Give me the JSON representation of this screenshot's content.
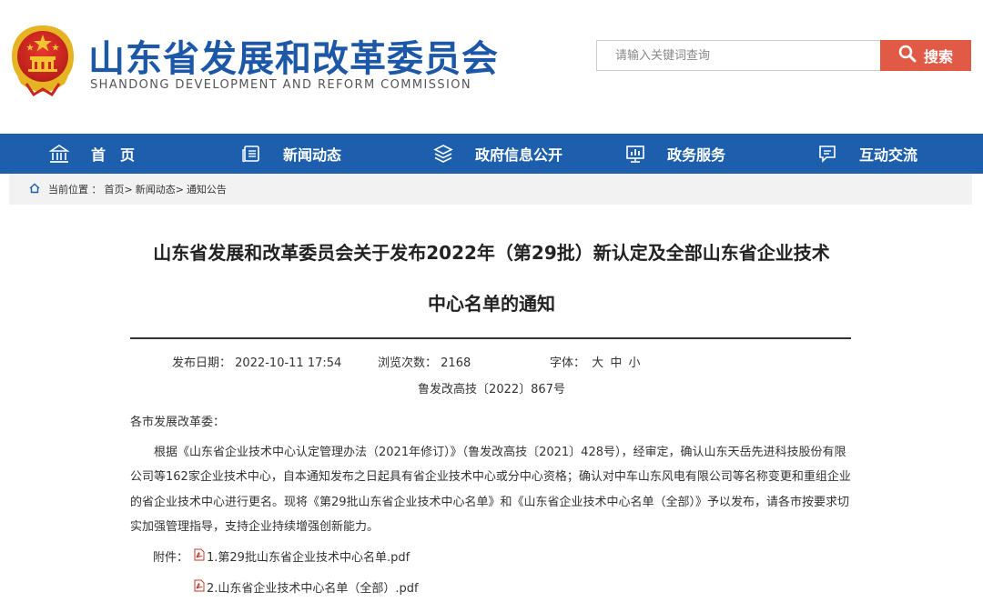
{
  "header": {
    "title": "山东省发展和改革委员会",
    "subtitle": "SHANDONG DEVELOPMENT AND REFORM COMMISSION",
    "search_placeholder": "请输入关键词查询",
    "search_button": "搜索"
  },
  "nav": {
    "items": [
      {
        "label": "首　页",
        "icon": "home-icon"
      },
      {
        "label": "新闻动态",
        "icon": "news-icon"
      },
      {
        "label": "政府信息公开",
        "icon": "layers-icon"
      },
      {
        "label": "政务服务",
        "icon": "chart-monitor-icon"
      },
      {
        "label": "互动交流",
        "icon": "chat-icon"
      }
    ]
  },
  "breadcrumb": {
    "prefix": "当前位置 ：",
    "items": [
      "首页",
      "新闻动态",
      "通知公告"
    ],
    "separator": ">"
  },
  "article": {
    "title_line1": "山东省发展和改革委员会关于发布2022年（第29批）新认定及全部山东省企业技术",
    "title_line2": "中心名单的通知",
    "date_label": "发布日期：",
    "date_value": "2022-10-11 17:54",
    "views_label": "浏览次数：",
    "views_value": "2168",
    "font_label": "字体：",
    "font_options": [
      "大",
      "中",
      "小"
    ],
    "doc_number": "鲁发改高技〔2022〕867号",
    "salutation": "各市发展改革委：",
    "body": "根据《山东省企业技术中心认定管理办法（2021年修订）》（鲁发改高技〔2021〕428号），经审定，确认山东天岳先进科技股份有限公司等162家企业技术中心，自本通知发布之日起具有省企业技术中心或分中心资格；确认对中车山东风电有限公司等名称变更和重组企业的省企业技术中心进行更名。现将《第29批山东省企业技术中心名单》和《山东省企业技术中心名单（全部）》予以发布，请各市按要求切实加强管理指导，支持企业持续增强创新能力。",
    "attachments_label": "附件：",
    "attachments": [
      "1.第29批山东省企业技术中心名单.pdf",
      "2.山东省企业技术中心名单（全部）.pdf"
    ]
  },
  "colors": {
    "brand_blue": "#1d58a8",
    "nav_blue": "#1d5fac",
    "search_red": "#e05a46"
  }
}
